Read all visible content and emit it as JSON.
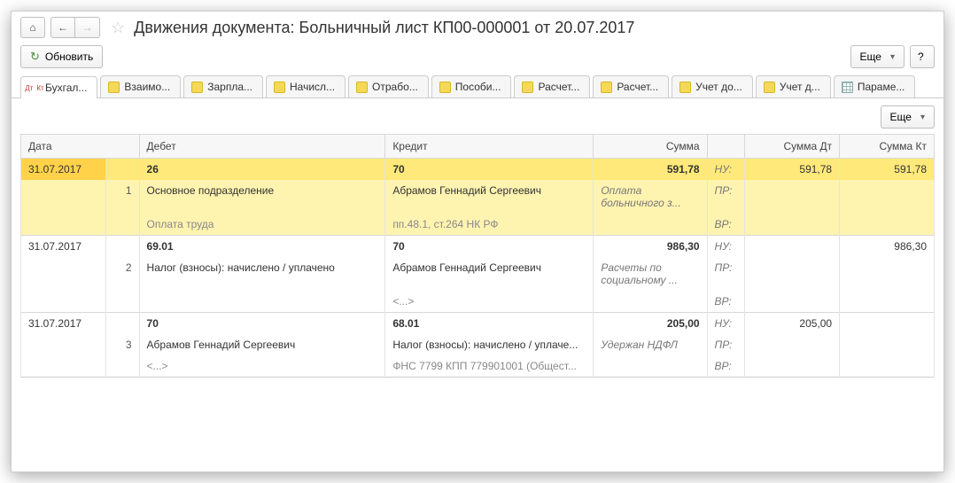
{
  "header": {
    "title": "Движения документа: Больничный лист КП00-000001 от 20.07.2017"
  },
  "actions": {
    "refresh": "Обновить",
    "more": "Еще",
    "help": "?"
  },
  "tabs": [
    {
      "label": "Бухгал...",
      "icon": "dtkt",
      "active": true
    },
    {
      "label": "Взаимо...",
      "icon": "yellow"
    },
    {
      "label": "Зарпла...",
      "icon": "yellow"
    },
    {
      "label": "Начисл...",
      "icon": "yellow"
    },
    {
      "label": "Отрабо...",
      "icon": "yellow"
    },
    {
      "label": "Пособи...",
      "icon": "yellow"
    },
    {
      "label": "Расчет...",
      "icon": "yellow"
    },
    {
      "label": "Расчет...",
      "icon": "yellow"
    },
    {
      "label": "Учет до...",
      "icon": "yellow"
    },
    {
      "label": "Учет д...",
      "icon": "yellow"
    },
    {
      "label": "Параме...",
      "icon": "grid"
    }
  ],
  "table": {
    "columns": {
      "date": "Дата",
      "debit": "Дебет",
      "credit": "Кредит",
      "sum": "Сумма",
      "sum_dt": "Сумма Дт",
      "sum_kt": "Сумма Кт"
    },
    "tags": {
      "nu": "НУ:",
      "pr": "ПР:",
      "vr": "ВР:"
    },
    "entries": [
      {
        "highlight": true,
        "date": "31.07.2017",
        "index": "1",
        "debit_acc": "26",
        "credit_acc": "70",
        "sum": "591,78",
        "sum_dt": "591,78",
        "sum_kt": "591,78",
        "desc": "Оплата больничного з...",
        "debit_l1": "Основное подразделение",
        "debit_l2": "Оплата труда",
        "credit_l1": "Абрамов Геннадий Сергеевич",
        "credit_l2": "пп.48.1, ст.264 НК РФ"
      },
      {
        "date": "31.07.2017",
        "index": "2",
        "debit_acc": "69.01",
        "credit_acc": "70",
        "sum": "986,30",
        "sum_dt": "",
        "sum_kt": "986,30",
        "desc": "Расчеты по социальному ...",
        "debit_l1": "Налог (взносы): начислено / уплачено",
        "debit_l2": "",
        "credit_l1": "Абрамов Геннадий Сергеевич",
        "credit_l2": "<...>"
      },
      {
        "date": "31.07.2017",
        "index": "3",
        "debit_acc": "70",
        "credit_acc": "68.01",
        "sum": "205,00",
        "sum_dt": "205,00",
        "sum_kt": "",
        "desc": "Удержан НДФЛ",
        "debit_l1": "Абрамов Геннадий Сергеевич",
        "debit_l2": "<...>",
        "credit_l1": "Налог (взносы): начислено / уплаче...",
        "credit_l2": "ФНС 7799 КПП 779901001 (Общест..."
      }
    ]
  }
}
